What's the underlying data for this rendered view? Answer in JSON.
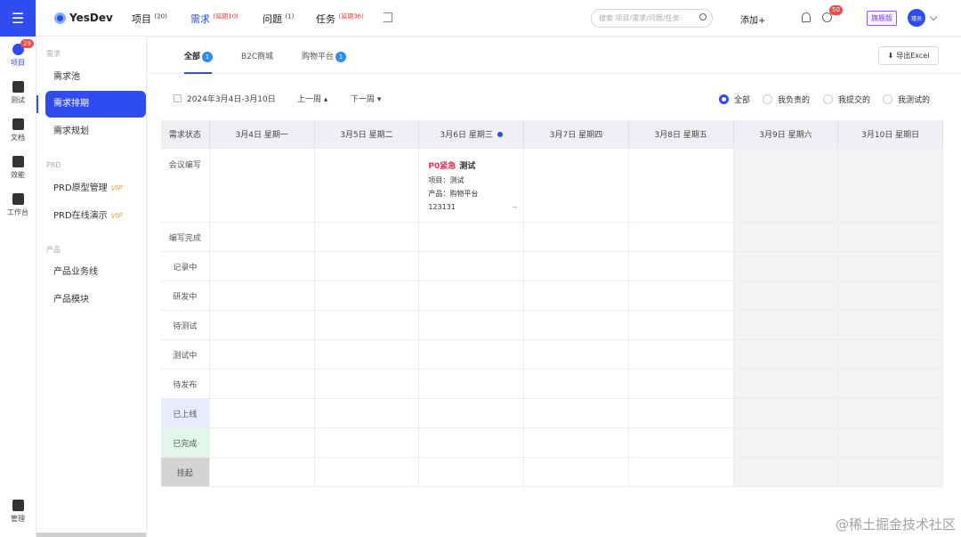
{
  "rail": {
    "items": [
      {
        "label": "项目",
        "badge": "29",
        "icon": "cube-icon"
      },
      {
        "label": "测试",
        "icon": "test-icon"
      },
      {
        "label": "文档",
        "icon": "doc-icon"
      },
      {
        "label": "效能",
        "icon": "chart-icon"
      },
      {
        "label": "工作台",
        "icon": "grid-icon"
      }
    ],
    "bottom_label": "管理"
  },
  "header": {
    "brand": "YesDev",
    "nav": [
      {
        "label": "项目",
        "sup": "(20)"
      },
      {
        "label": "需求",
        "sup": "(延期10)"
      },
      {
        "label": "问题",
        "sup": "(1)"
      },
      {
        "label": "任务",
        "sup": "(延期36)"
      }
    ],
    "search_placeholder": "搜索 项目/需求/问题/任务",
    "add_label": "添加+",
    "clock_badge": "50",
    "edition": "旗舰版",
    "avatar_text": "瑾员"
  },
  "sidebar": {
    "groups": [
      {
        "title": "需求",
        "items": [
          "需求池",
          "需求排期",
          "需求规划"
        ]
      },
      {
        "title": "PRD",
        "items": [
          "PRD原型管理",
          "PRD在线演示"
        ]
      },
      {
        "title": "产品",
        "items": [
          "产品业务线",
          "产品模块"
        ]
      }
    ],
    "vip": "VIP"
  },
  "tabs": [
    {
      "label": "全部",
      "badge": "1"
    },
    {
      "label": "B2C商城"
    },
    {
      "label": "购物平台",
      "badge": "1"
    }
  ],
  "export_label": "导出Excel",
  "toolbar": {
    "date_range": "2024年3月4日-3月10日",
    "prev_week": "上一周",
    "next_week": "下一周",
    "filters": [
      "全部",
      "我负责的",
      "我提交的",
      "我测试的"
    ]
  },
  "grid": {
    "status_header": "需求状态",
    "days": [
      "3月4日  星期一",
      "3月5日  星期二",
      "3月6日  星期三",
      "3月7日  星期四",
      "3月8日  星期五",
      "3月9日  星期六",
      "3月10日  星期日"
    ],
    "statuses": [
      "会议编写",
      "编写完成",
      "记录中",
      "研发中",
      "待测试",
      "测试中",
      "待发布",
      "已上线",
      "已完成",
      "挂起"
    ]
  },
  "card": {
    "priority": "P0紧急",
    "title": "测试",
    "project": "项目：测试",
    "product": "产品：购物平台",
    "code": "123131",
    "dash": "--"
  },
  "watermark": "@稀土掘金技术社区",
  "colors": {
    "accent": "#2f4cf0",
    "online": "#e8ebff",
    "done": "#e3f6ec",
    "pending": "#d4d4d4"
  }
}
